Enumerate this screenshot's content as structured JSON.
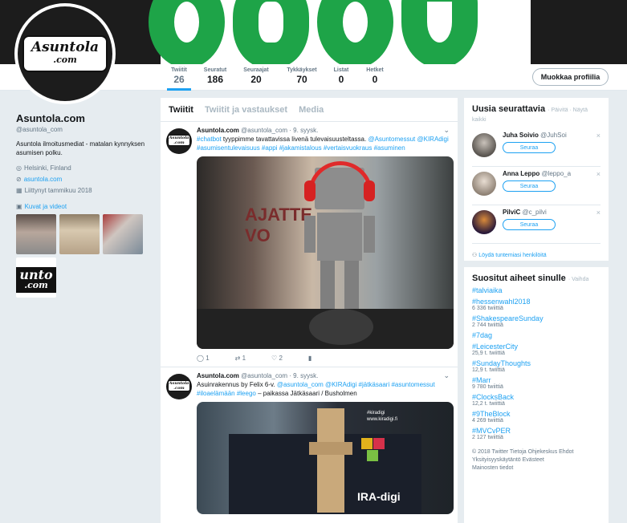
{
  "profile_nav": {
    "stats": [
      {
        "label": "Twiitit",
        "value": "26"
      },
      {
        "label": "Seuratut",
        "value": "186"
      },
      {
        "label": "Seuraajat",
        "value": "20"
      },
      {
        "label": "Tykkäykset",
        "value": "70"
      },
      {
        "label": "Listat",
        "value": "0"
      },
      {
        "label": "Hetket",
        "value": "0"
      }
    ],
    "edit_profile": "Muokkaa profiilia"
  },
  "logo": {
    "line1": "Asuntola",
    "line2": ".com",
    "banner_text": "suntola",
    "thumb_text": "unto",
    "thumb_text2": ".com"
  },
  "profile": {
    "name": "Asuntola.com",
    "handle": "@asuntola_com",
    "bio": "Asuntola ilmoitusmediat - matalan kynnyksen asumisen polku.",
    "location": "Helsinki, Finland",
    "website": "asuntola.com",
    "joined": "Liittynyt tammikuu 2018",
    "media_label": "Kuvat ja videot"
  },
  "timeline": {
    "tabs": [
      "Twiitit",
      "Twiitit ja vastaukset",
      "Media"
    ],
    "tweets": [
      {
        "name": "Asuntola.com",
        "meta": "@asuntola_com · 9. syysk.",
        "text_lead": "#chatbot",
        "text_body": " tyyppimme  tavattavissa livenä tulevaisuusteltassa. ",
        "text_tags": "@Asuntomessut @KIRAdigi #asumisentulevaisuus #appi #jakamistalous #vertaisvuokraus #asuminen",
        "replies": "1",
        "retweets": "1",
        "likes": "2"
      },
      {
        "name": "Asuntola.com",
        "meta": "@asuntola_com · 9. syysk.",
        "text_body": "Asuinrakennus by Felix 6-v. ",
        "text_tags": "@asuntola_com @KIRAdigi #jätkäsaari #asuntomessut #iloaelämään #leego",
        "text_place": " – paikassa Jätkäsaari / Busholmen",
        "media_caption1": "#kiradigi",
        "media_caption2": "www.kiradigi.fi",
        "media_caption3": "IRA-digi",
        "media_caption4": "AJATTE",
        "media_caption5": "VO"
      }
    ]
  },
  "who_to_follow": {
    "title": "Uusia seurattavia",
    "links": "· Päivitä · Näytä kaikki",
    "people": [
      {
        "name": "Juha Soivio",
        "handle": "@JuhSoi"
      },
      {
        "name": "Anna Leppo",
        "handle": "@leppo_a"
      },
      {
        "name": "PilviC",
        "handle": "@c_pilvi"
      }
    ],
    "follow_label": "Seuraa",
    "find_people": "Löydä tuntemiasi henkilöitä"
  },
  "trends": {
    "title": "Suositut aiheet sinulle",
    "change": "· Vaihda",
    "items": [
      {
        "name": "#talviaika",
        "count": ""
      },
      {
        "name": "#hessenwahl2018",
        "count": "6 336 twiittiä"
      },
      {
        "name": "#ShakespeareSunday",
        "count": "2 744 twiittiä"
      },
      {
        "name": "#7dag",
        "count": ""
      },
      {
        "name": "#LeicesterCity",
        "count": "25,9 t. twiittiä"
      },
      {
        "name": "#SundayThoughts",
        "count": "12,9 t. twiittiä"
      },
      {
        "name": "#Marr",
        "count": "9 780 twiittiä"
      },
      {
        "name": "#ClocksBack",
        "count": "12,2 t. twiittiä"
      },
      {
        "name": "#9TheBlock",
        "count": "4 269 twiittiä"
      },
      {
        "name": "#MVCvPER",
        "count": "2 127 twiittiä"
      }
    ],
    "footer1": "© 2018 Twitter  Tietoja  Ohjekeskus  Ehdot",
    "footer2": "Yksityisyyskäytäntö  Evästeet",
    "footer3": "Mainosten tiedot"
  },
  "colors": {
    "accent": "#1da1f2",
    "brand_green": "#1ea448",
    "dark": "#1c1c1c",
    "heart_red": "#e0245e"
  }
}
